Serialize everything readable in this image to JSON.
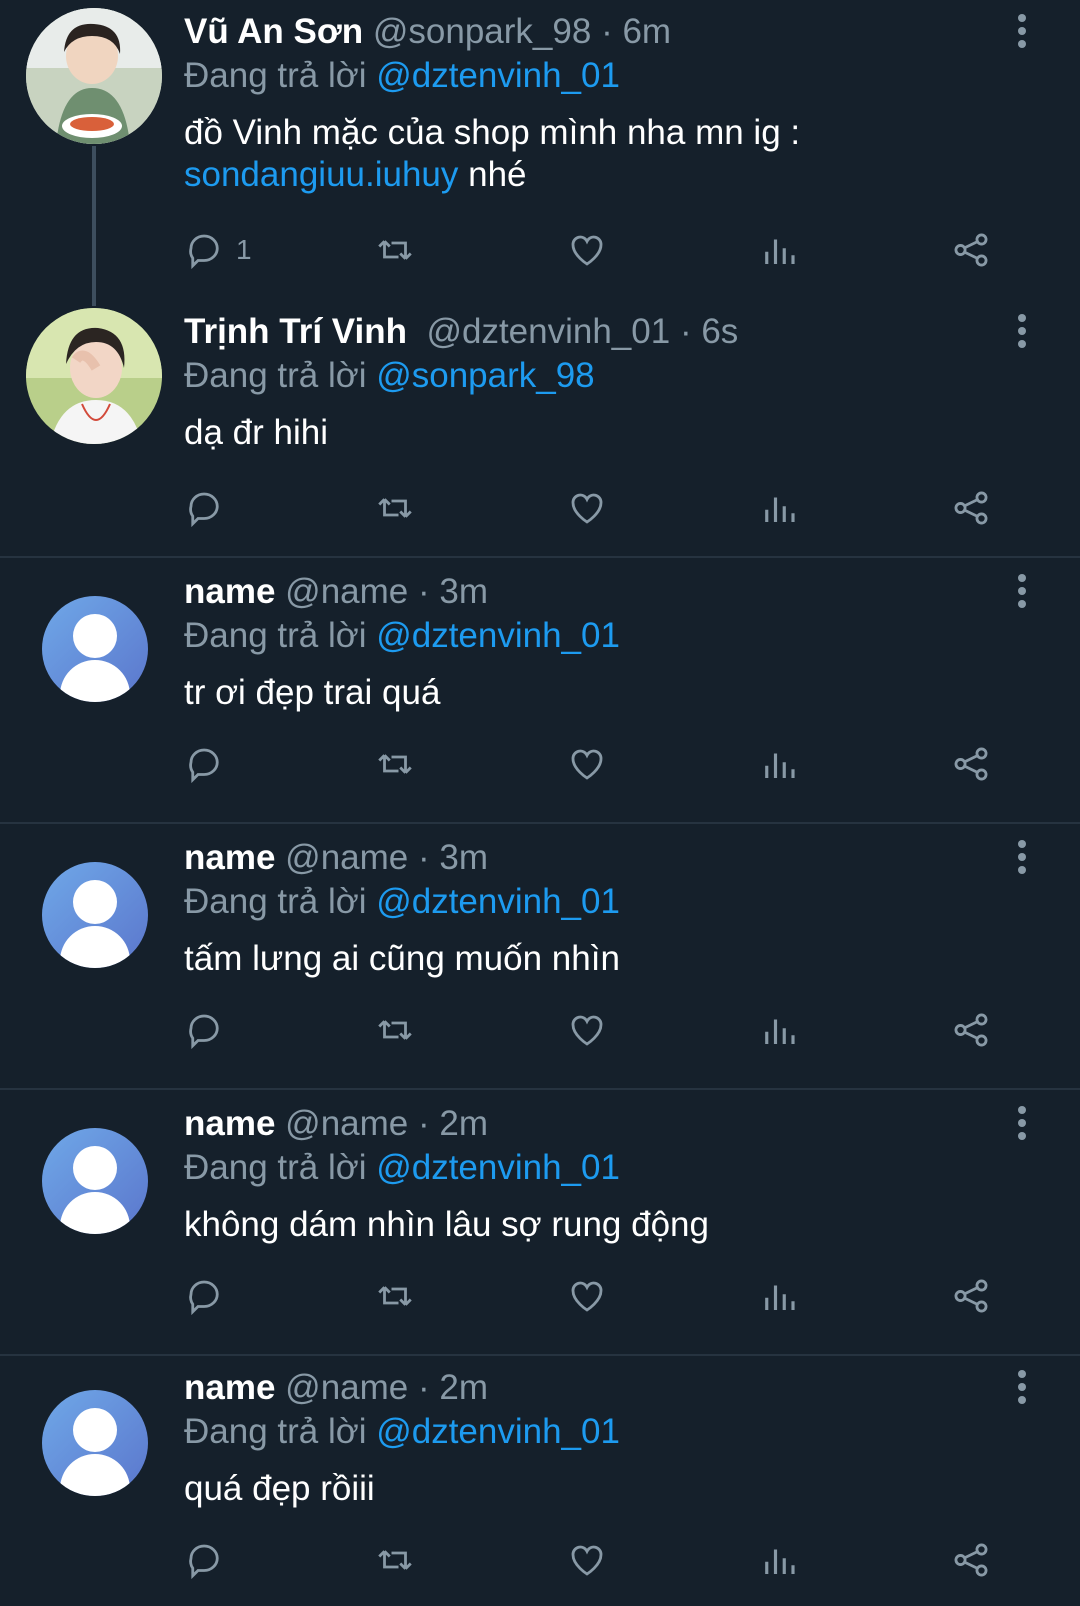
{
  "reply_prefix": "Đang trả lời",
  "tweets": [
    {
      "name": "Vũ An Sơn",
      "handle": "@sonpark_98",
      "time": "6m",
      "reply_to": "@dztenvinh_01",
      "text": "đồ Vinh mặc của shop mình nha mn ig :",
      "link": "sondangiuu.iuhuy",
      "text_after": " nhé",
      "reply_count": "1"
    },
    {
      "name": "Trịnh Trí Vinh",
      "handle": "@dztenvinh_01",
      "time": "6s",
      "reply_to": "@sonpark_98",
      "text": "dạ đr hihi"
    },
    {
      "name": "name",
      "handle": "@name",
      "time": "3m",
      "reply_to": "@dztenvinh_01",
      "text": "tr ơi đẹp trai quá"
    },
    {
      "name": "name",
      "handle": "@name",
      "time": "3m",
      "reply_to": "@dztenvinh_01",
      "text": "tấm lưng ai cũng muốn nhìn"
    },
    {
      "name": "name",
      "handle": "@name",
      "time": "2m",
      "reply_to": "@dztenvinh_01",
      "text": "không dám nhìn lâu sợ rung động"
    },
    {
      "name": "name",
      "handle": "@name",
      "time": "2m",
      "reply_to": "@dztenvinh_01",
      "text": "quá đẹp rồiii"
    }
  ],
  "dot_separator": "·",
  "icons": {
    "reply": "comment-icon",
    "retweet": "retweet-icon",
    "like": "heart-icon",
    "views": "analytics-icon",
    "share": "share-icon",
    "more": "more-vertical-icon"
  },
  "colors": {
    "background": "#15202b",
    "link": "#1d9bf0",
    "muted": "#8899a6"
  }
}
